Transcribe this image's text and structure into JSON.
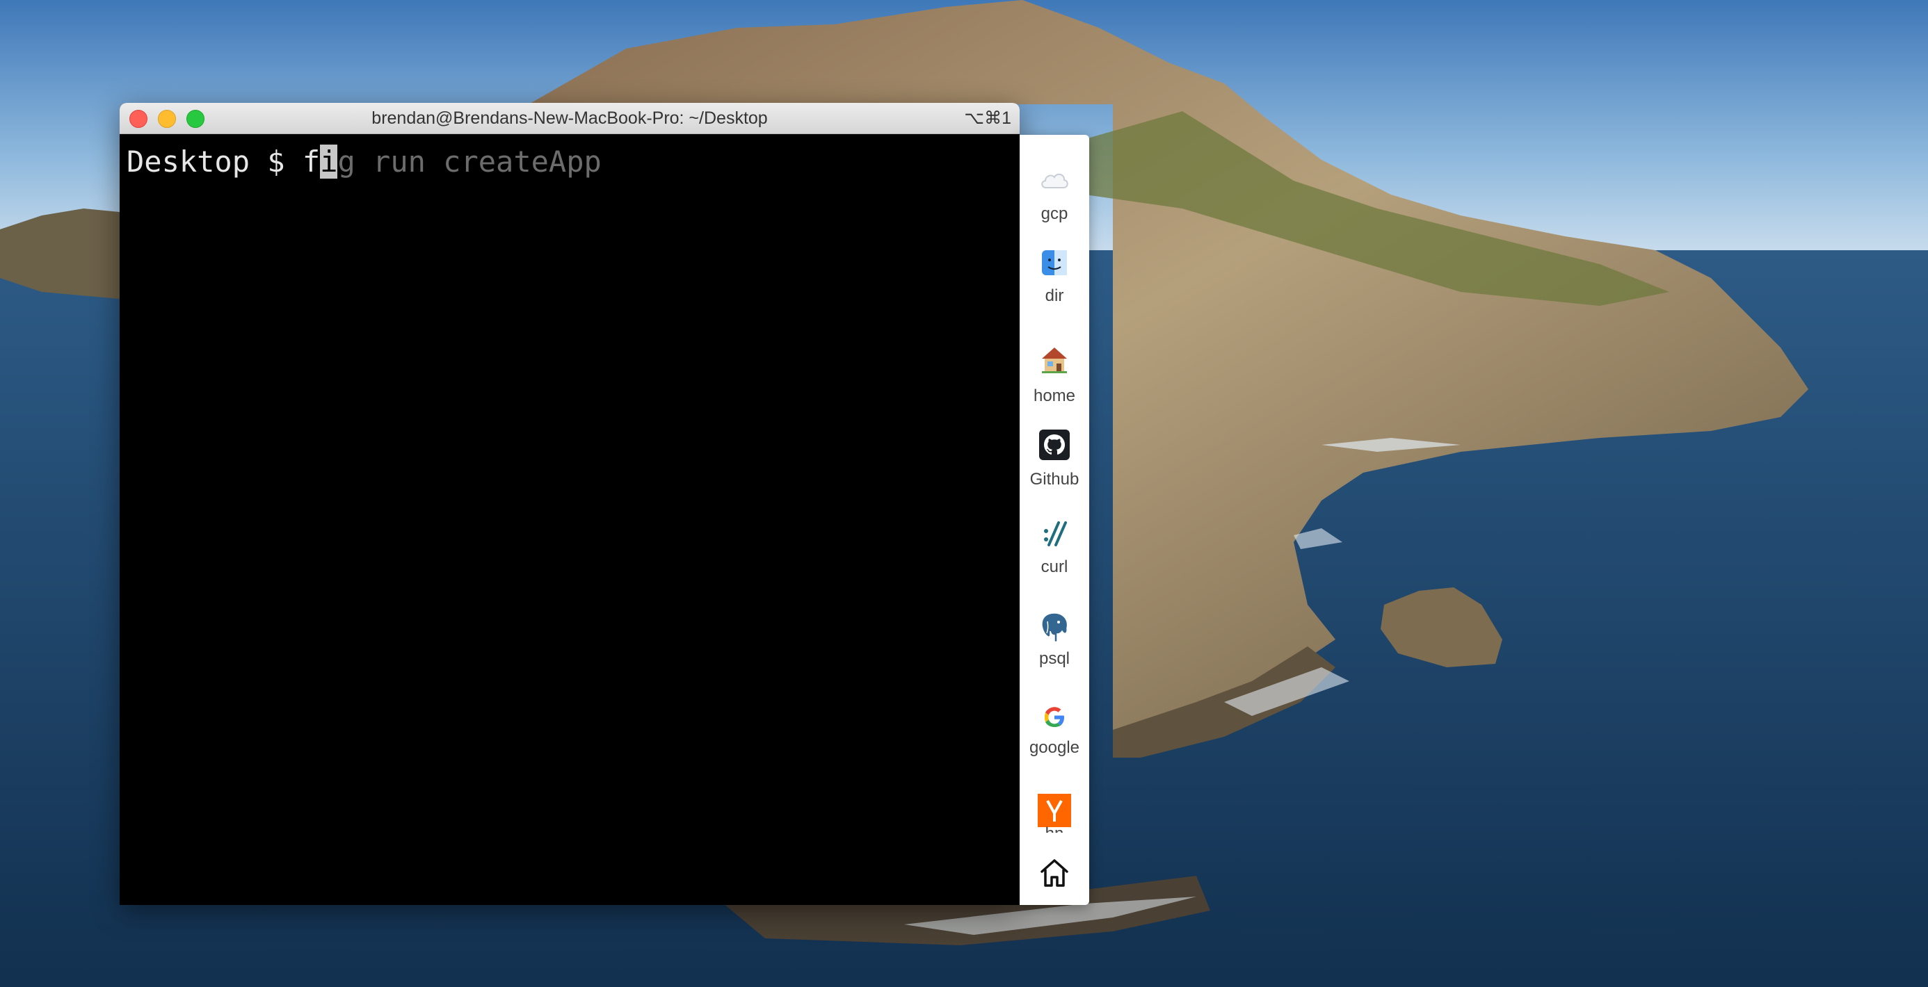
{
  "window": {
    "title": "brendan@Brendans-New-MacBook-Pro: ~/Desktop",
    "shortcut": "⌥⌘1",
    "buttons": {
      "close": "close",
      "minimize": "minimize",
      "maximize": "maximize"
    }
  },
  "terminal": {
    "prompt": "Desktop $ ",
    "typed_before_cursor": "f",
    "cursor_char": "i",
    "ghost_suggestion": "g run createApp",
    "colors": {
      "background": "#000000",
      "text": "#e6e6e6",
      "ghost": "#6c6c6c"
    }
  },
  "fig_sidebar": {
    "items": [
      {
        "label": "gcp",
        "icon": "cloud-icon"
      },
      {
        "label": "dir",
        "icon": "finder-icon"
      },
      {
        "label": "home",
        "icon": "house-icon"
      },
      {
        "label": "Github",
        "icon": "github-icon"
      },
      {
        "label": "curl",
        "icon": "curl-icon"
      },
      {
        "label": "psql",
        "icon": "postgres-elephant-icon"
      },
      {
        "label": "google",
        "icon": "google-icon"
      },
      {
        "label": "hn",
        "icon": "hacker-news-icon"
      }
    ],
    "home_button_icon": "home-outline-icon"
  }
}
